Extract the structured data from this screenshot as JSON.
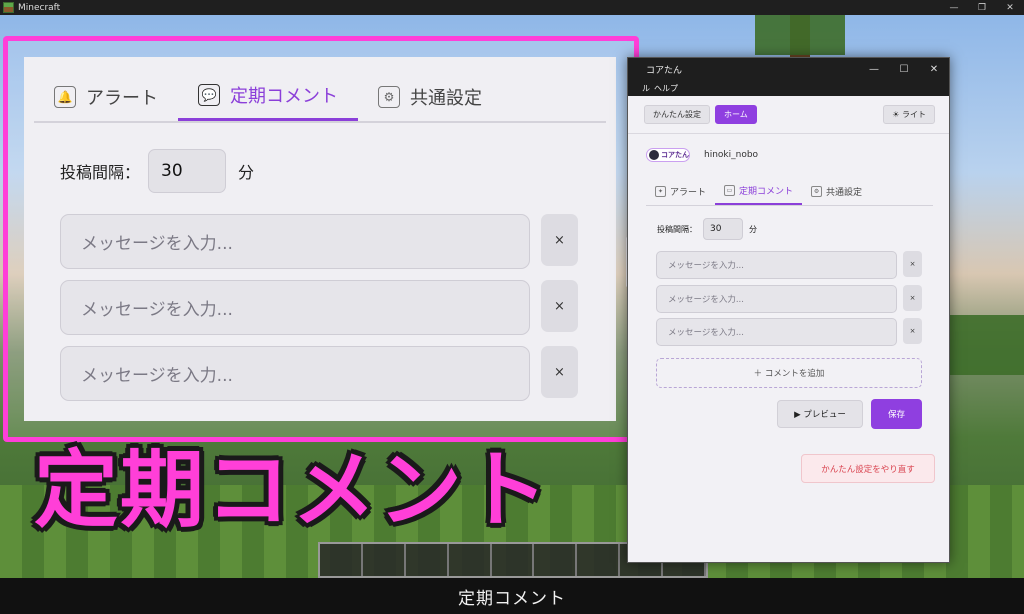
{
  "mc_window": {
    "title": "Minecraft",
    "controls": [
      "—",
      "❐",
      "✕"
    ]
  },
  "caption": "定期コメント",
  "headline": "定期コメント",
  "zoom": {
    "tabs": [
      {
        "label": "アラート",
        "icon": "bell-icon",
        "glyph": "🔔"
      },
      {
        "label": "定期コメント",
        "icon": "chat-icon",
        "glyph": "💬"
      },
      {
        "label": "共通設定",
        "icon": "gear-icon",
        "glyph": "⚙"
      }
    ],
    "interval_label": "投稿間隔：",
    "interval_value": "30",
    "interval_unit": "分",
    "message_placeholder": "メッセージを入力...",
    "delete_glyph": "×"
  },
  "app": {
    "title": "コアたん",
    "controls": [
      "—",
      "☐",
      "✕"
    ],
    "menu": [
      "ル",
      "ヘルプ"
    ],
    "toolbar": {
      "easy_setup": "かんたん設定",
      "home": "ホーム",
      "light": "☀ ライト"
    },
    "logo_text": "コアたん",
    "username": "hinoki_nobo",
    "tabs": [
      "アラート",
      "定期コメント",
      "共通設定"
    ],
    "interval_label": "投稿間隔：",
    "interval_value": "30",
    "interval_unit": "分",
    "message_placeholder": "メッセージを入力...",
    "delete_glyph": "×",
    "add_comment": "＋ コメントを追加",
    "preview": "▶ プレビュー",
    "save": "保存",
    "reset_easy": "かんたん設定をやり直す"
  },
  "colors": {
    "accent": "#8f3fe0",
    "callout": "#ff3fd8",
    "danger": "#d9434f"
  }
}
